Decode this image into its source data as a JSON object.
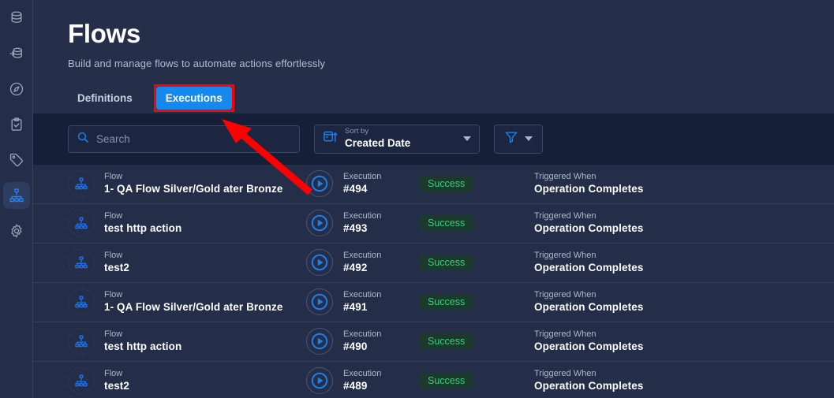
{
  "sidebar": {
    "items": [
      {
        "name": "database-icon",
        "label": "Database",
        "active": false
      },
      {
        "name": "database-import-icon",
        "label": "Data Import",
        "active": false
      },
      {
        "name": "compass-icon",
        "label": "Explore",
        "active": false
      },
      {
        "name": "clipboard-check-icon",
        "label": "Tasks",
        "active": false
      },
      {
        "name": "tag-icon",
        "label": "Tags",
        "active": false
      },
      {
        "name": "sitemap-icon",
        "label": "Flows",
        "active": true
      },
      {
        "name": "gear-icon",
        "label": "Settings",
        "active": false
      }
    ]
  },
  "header": {
    "title": "Flows",
    "subtitle": "Build and manage flows to automate actions effortlessly"
  },
  "tabs": [
    {
      "label": "Definitions",
      "active": false,
      "highlighted": false
    },
    {
      "label": "Executions",
      "active": true,
      "highlighted": true
    }
  ],
  "toolbar": {
    "search": {
      "placeholder": "Search",
      "value": ""
    },
    "sort": {
      "label": "Sort by",
      "value": "Created Date"
    },
    "filter": {
      "label": "Filter"
    }
  },
  "list": {
    "flow_label": "Flow",
    "execution_label": "Execution",
    "trigger_label": "Triggered When",
    "rows": [
      {
        "flow": "1- QA Flow Silver/Gold ater Bronze",
        "execution": "#494",
        "status": "Success",
        "trigger": "Operation Completes"
      },
      {
        "flow": "test http action",
        "execution": "#493",
        "status": "Success",
        "trigger": "Operation Completes"
      },
      {
        "flow": "test2",
        "execution": "#492",
        "status": "Success",
        "trigger": "Operation Completes"
      },
      {
        "flow": "1- QA Flow Silver/Gold ater Bronze",
        "execution": "#491",
        "status": "Success",
        "trigger": "Operation Completes"
      },
      {
        "flow": "test http action",
        "execution": "#490",
        "status": "Success",
        "trigger": "Operation Completes"
      },
      {
        "flow": "test2",
        "execution": "#489",
        "status": "Success",
        "trigger": "Operation Completes"
      }
    ]
  },
  "colors": {
    "accent": "#1589ee",
    "annotation": "#fe0000",
    "success_text": "#36d07a",
    "success_bg": "#1b3a2d",
    "header_bg": "#252f4a",
    "row_bg": "#242e48",
    "page_bg": "#151d33"
  }
}
